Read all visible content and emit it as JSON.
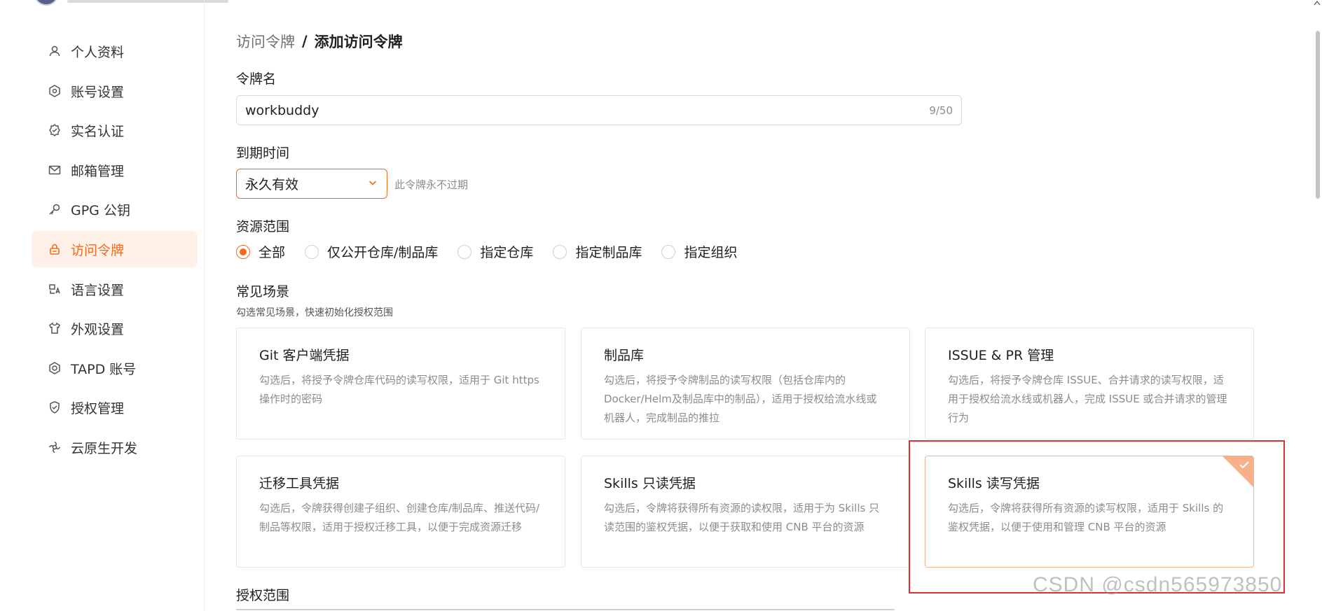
{
  "sidebar": {
    "items": [
      {
        "label": "个人资料",
        "icon": "user-icon"
      },
      {
        "label": "账号设置",
        "icon": "gear-icon"
      },
      {
        "label": "实名认证",
        "icon": "verified-badge-icon"
      },
      {
        "label": "邮箱管理",
        "icon": "mail-icon"
      },
      {
        "label": "GPG 公钥",
        "icon": "key-icon"
      },
      {
        "label": "访问令牌",
        "icon": "lock-icon",
        "active": true
      },
      {
        "label": "语言设置",
        "icon": "translate-icon"
      },
      {
        "label": "外观设置",
        "icon": "shirt-icon"
      },
      {
        "label": "TAPD 账号",
        "icon": "hexagon-icon"
      },
      {
        "label": "授权管理",
        "icon": "shield-check-icon"
      },
      {
        "label": "云原生开发",
        "icon": "cloud-dev-icon"
      }
    ]
  },
  "breadcrumb": {
    "parent": "访问令牌",
    "separator": "/",
    "current": "添加访问令牌"
  },
  "form": {
    "name_label": "令牌名",
    "name_value": "workbuddy",
    "name_count": "9/50",
    "expire_label": "到期时间",
    "expire_value": "永久有效",
    "expire_hint": "此令牌永不过期",
    "scope_label": "资源范围",
    "scope_options": [
      {
        "label": "全部",
        "checked": true
      },
      {
        "label": "仅公开仓库/制品库",
        "checked": false
      },
      {
        "label": "指定仓库",
        "checked": false
      },
      {
        "label": "指定制品库",
        "checked": false
      },
      {
        "label": "指定组织",
        "checked": false
      }
    ],
    "scenes_label": "常见场景",
    "scenes_hint": "勾选常见场景，快速初始化授权范围",
    "scenes": [
      {
        "title": "Git 客户端凭据",
        "desc": "勾选后，将授予令牌仓库代码的读写权限，适用于 Git https 操作时的密码",
        "selected": false
      },
      {
        "title": "制品库",
        "desc": "勾选后，将授予令牌制品的读写权限（包括仓库内的 Docker/Helm及制品库中的制品），适用于授权给流水线或机器人，完成制品的推拉",
        "selected": false
      },
      {
        "title": "ISSUE & PR 管理",
        "desc": "勾选后，将授予令牌仓库 ISSUE、合并请求的读写权限，适用于授权给流水线或机器人，完成 ISSUE 或合并请求的管理行为",
        "selected": false
      },
      {
        "title": "迁移工具凭据",
        "desc": "勾选后，令牌获得创建子组织、创建仓库/制品库、推送代码/制品等权限，适用于授权迁移工具，以便于完成资源迁移",
        "selected": false
      },
      {
        "title": "Skills 只读凭据",
        "desc": "勾选后，令牌将获得所有资源的读权限，适用于为 Skills 只读范围的鉴权凭据，以便于获取和使用 CNB 平台的资源",
        "selected": false
      },
      {
        "title": "Skills 读写凭据",
        "desc": "勾选后，令牌将获得所有资源的读写权限，适用于 Skills 的鉴权凭据，以便于使用和管理 CNB 平台的资源",
        "selected": true
      }
    ],
    "auth_scope_label": "授权范围"
  },
  "watermark": "CSDN @csdn565973850",
  "colors": {
    "accent": "#f26b1d",
    "active_bg": "#fff1e8",
    "highlight": "#e03030"
  }
}
